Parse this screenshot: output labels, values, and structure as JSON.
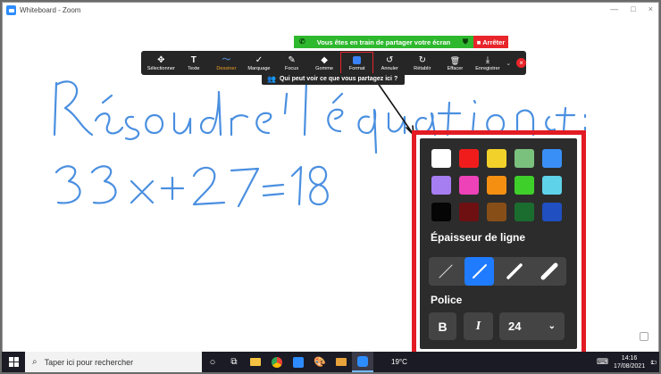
{
  "window": {
    "title": "Whiteboard - Zoom",
    "controls": [
      "—",
      "□",
      "×"
    ]
  },
  "share_banner": {
    "message": "Vous êtes en train de partager votre écran",
    "stop_label": "Arrêter",
    "green_color": "#2eb82e",
    "stop_color": "#e8252a"
  },
  "toolbar": {
    "tools": [
      {
        "label": "Sélectionner",
        "icon": "move-icon",
        "glyph": "✥"
      },
      {
        "label": "Texte",
        "icon": "text-icon",
        "glyph": "T"
      },
      {
        "label": "Dessiner",
        "icon": "draw-icon",
        "glyph": "〜"
      },
      {
        "label": "Marquage",
        "icon": "stamp-icon",
        "glyph": "✓"
      },
      {
        "label": "Focus",
        "icon": "spotlight-icon",
        "glyph": "✎"
      },
      {
        "label": "Gomme",
        "icon": "eraser-icon",
        "glyph": "◆"
      },
      {
        "label": "Format",
        "icon": "format-icon",
        "glyph": ""
      },
      {
        "label": "Annuler",
        "icon": "undo-icon",
        "glyph": "↺"
      },
      {
        "label": "Rétablir",
        "icon": "redo-icon",
        "glyph": "↻"
      },
      {
        "label": "Effacer",
        "icon": "trash-icon",
        "glyph": "🗑"
      },
      {
        "label": "Enregistrer",
        "icon": "save-icon",
        "glyph": "⤓"
      }
    ],
    "active_tool": "Dessiner",
    "boxed_tool": "Format",
    "active_color": "#f0a028"
  },
  "tooltip": {
    "text": "Qui peut voir ce que vous partagez ici ?"
  },
  "whiteboard": {
    "ink_color": "#4a8fe0"
  },
  "format_panel": {
    "colors": [
      [
        "#ffffff",
        "#f01c1c",
        "#f2d22a",
        "#7bc17e",
        "#3a8ff7"
      ],
      [
        "#a77df2",
        "#ee42b8",
        "#f58f12",
        "#3fcf2a",
        "#5ed2e8"
      ],
      [
        "#050505",
        "#6e0f12",
        "#874e17",
        "#1a6d2f",
        "#1f4fc0"
      ]
    ],
    "line_width_label": "Épaisseur de ligne",
    "line_widths": [
      1,
      2,
      4,
      6
    ],
    "selected_line_width": 1,
    "font_label": "Police",
    "bold_label": "B",
    "italic_label": "I",
    "font_size": "24",
    "highlight_color": "#e31b23"
  },
  "taskbar": {
    "search_placeholder": "Taper ici pour rechercher",
    "apps": [
      "cortana-icon",
      "task-view-icon",
      "file-explorer-icon",
      "chrome-icon",
      "app-icon",
      "paint-icon",
      "folder-icon",
      "zoom-icon"
    ],
    "weather": "19°C",
    "time": "14:16",
    "date": "17/08/2021",
    "notifications": "1"
  }
}
